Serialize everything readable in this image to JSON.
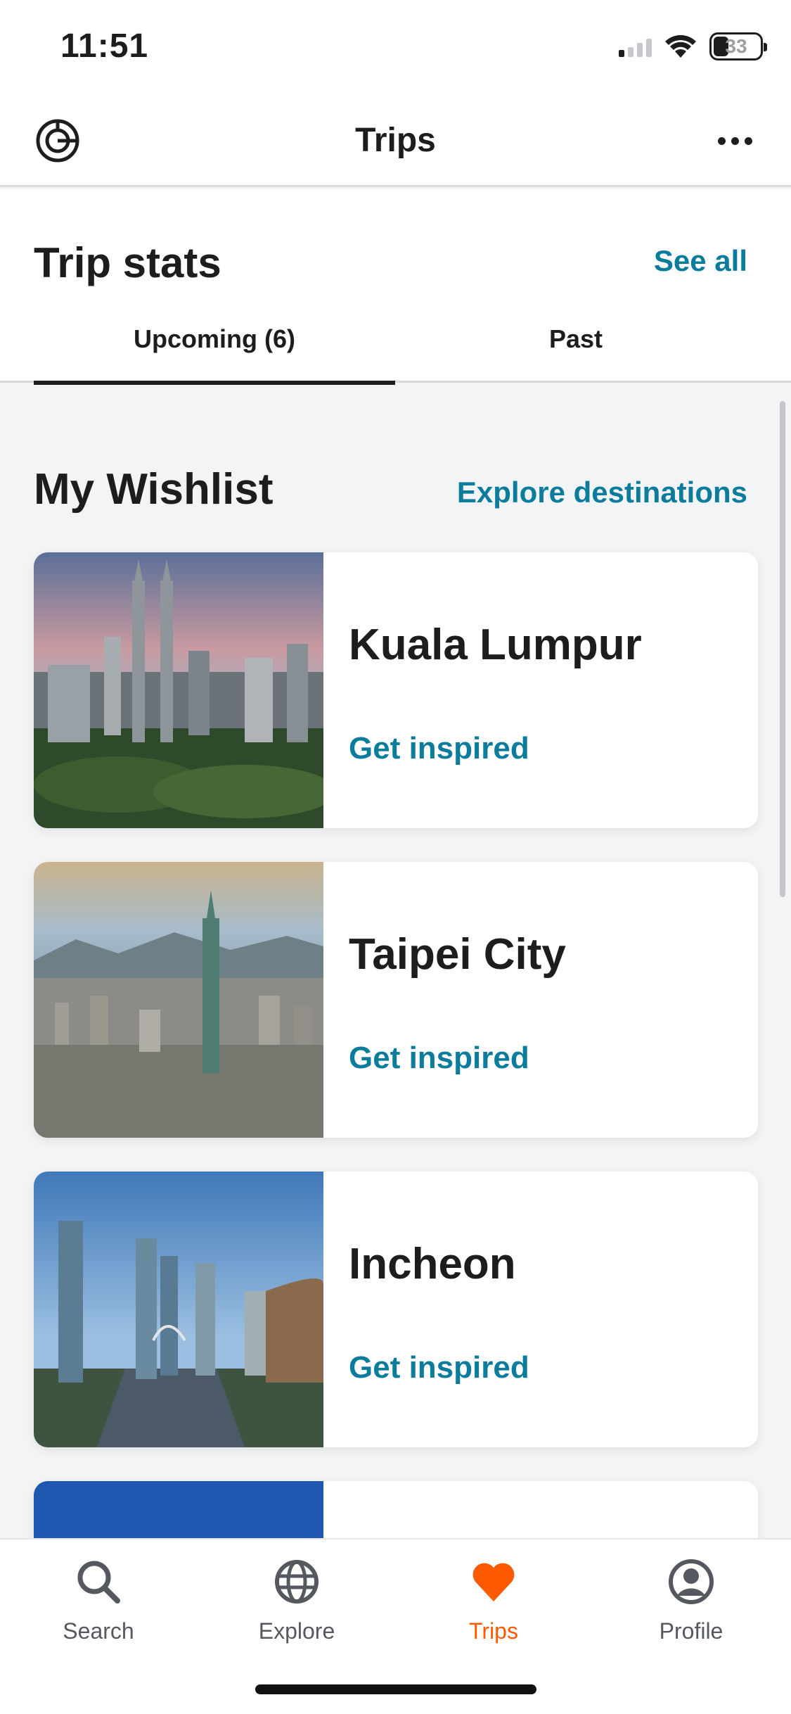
{
  "status_bar": {
    "time": "11:51",
    "battery": "33"
  },
  "header": {
    "title": "Trips",
    "logo_icon": "orbit-logo-icon",
    "more_icon": "more-horizontal-icon"
  },
  "trip_stats": {
    "title": "Trip stats",
    "see_all": "See all",
    "tabs": [
      {
        "label": "Upcoming (6)",
        "active": true
      },
      {
        "label": "Past",
        "active": false
      }
    ]
  },
  "wishlist": {
    "title": "My Wishlist",
    "explore_link": "Explore destinations",
    "items": [
      {
        "name": "Kuala Lumpur",
        "link": "Get inspired"
      },
      {
        "name": "Taipei City",
        "link": "Get inspired"
      },
      {
        "name": "Incheon",
        "link": "Get inspired"
      },
      {
        "name": "",
        "link": ""
      }
    ]
  },
  "nav": {
    "items": [
      {
        "label": "Search",
        "icon": "search-icon",
        "active": false
      },
      {
        "label": "Explore",
        "icon": "globe-icon",
        "active": false
      },
      {
        "label": "Trips",
        "icon": "heart-icon",
        "active": true
      },
      {
        "label": "Profile",
        "icon": "user-circle-icon",
        "active": false
      }
    ]
  },
  "colors": {
    "accent": "#0b7c9b",
    "active_nav": "#ff5a00",
    "text": "#1d1d1f"
  }
}
